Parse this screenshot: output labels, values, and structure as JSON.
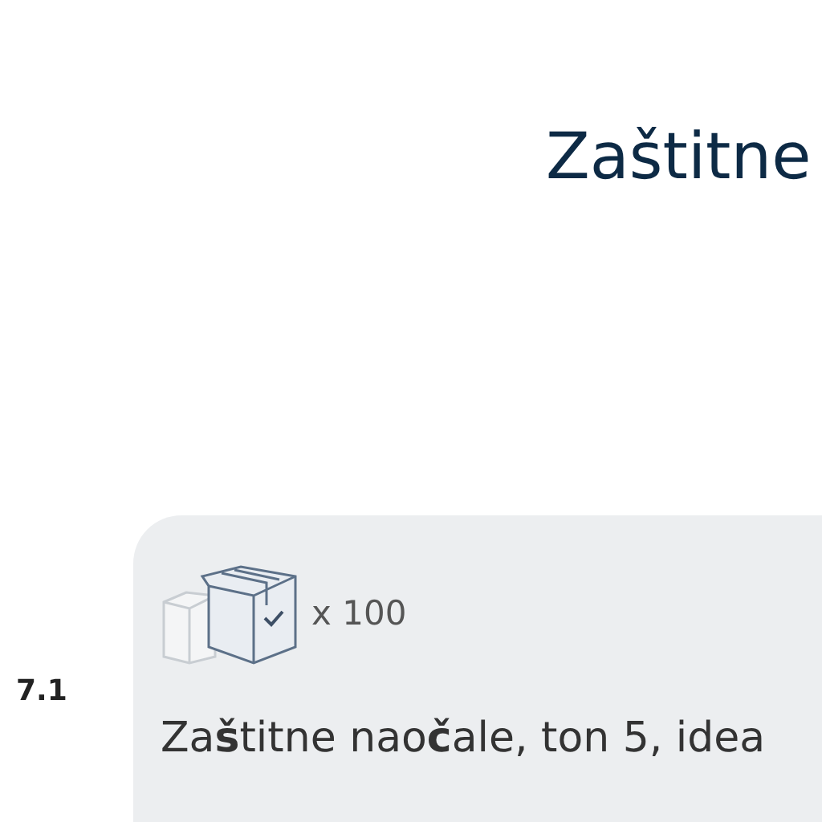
{
  "title": "Zaštitne",
  "code": "7.1",
  "product": {
    "quantity": "x 100",
    "description": "Za**š**titne nao**č**ale, ton 5, idea"
  }
}
